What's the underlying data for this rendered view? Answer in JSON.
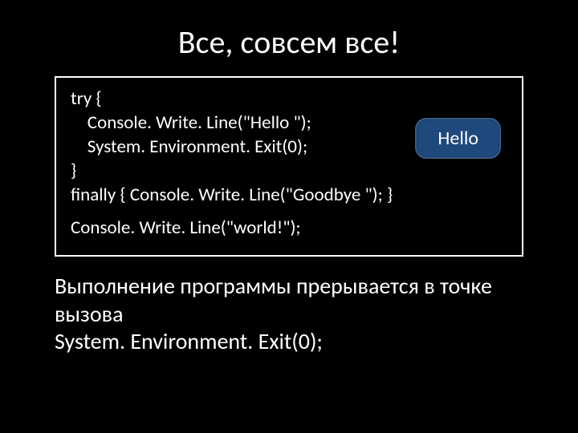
{
  "title": "Все, совсем все!",
  "code": {
    "l1": "try {",
    "l2": "    Console. Write. Line(\"Hello \");",
    "l3": "    System. Environment. Exit(0);",
    "l4": "}",
    "l5": "finally { Console. Write. Line(\"Goodbye \"); }",
    "l6": "Console. Write. Line(\"world!\");"
  },
  "callout": "Hello",
  "description": {
    "p1": "Выполнение программы прерывается в точке вызова",
    "p2": "System. Environment. Exit(0);"
  }
}
